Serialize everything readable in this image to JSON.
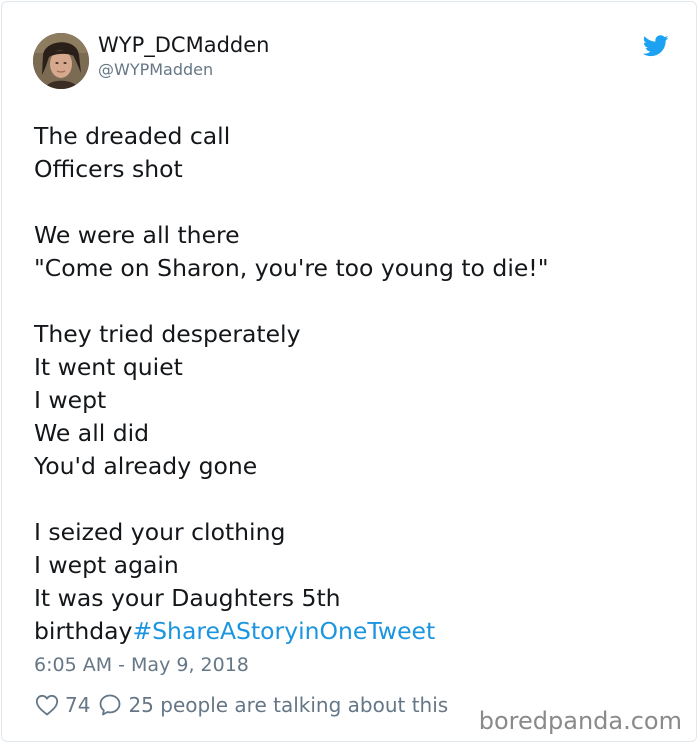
{
  "author": {
    "display_name": "WYP_DCMadden",
    "handle": "@WYPMadden"
  },
  "icons": {
    "brand": "twitter-bird-icon",
    "like": "heart-icon",
    "reply": "speech-bubble-icon"
  },
  "colors": {
    "brand_blue": "#1da1f2",
    "hashtag_blue": "#1b95e0",
    "meta_gray": "#657786",
    "text_dark": "#14171a"
  },
  "tweet": {
    "lines": [
      "The dreaded call",
      "Officers shot",
      "",
      "We were all there",
      "\"Come on Sharon, you're too young to die!\"",
      "",
      "They tried desperately",
      "It went quiet",
      "I wept",
      "We all did",
      "You'd already gone",
      "",
      "I seized your clothing",
      "I wept again",
      "It was your Daughters 5th"
    ],
    "last_line_text": "birthday",
    "hashtag": "#ShareAStoryinOneTweet",
    "timestamp": "6:05 AM - May 9, 2018"
  },
  "engagement": {
    "likes": "74",
    "talk_text": "25 people are talking about this"
  },
  "watermark": "boredpanda.com"
}
